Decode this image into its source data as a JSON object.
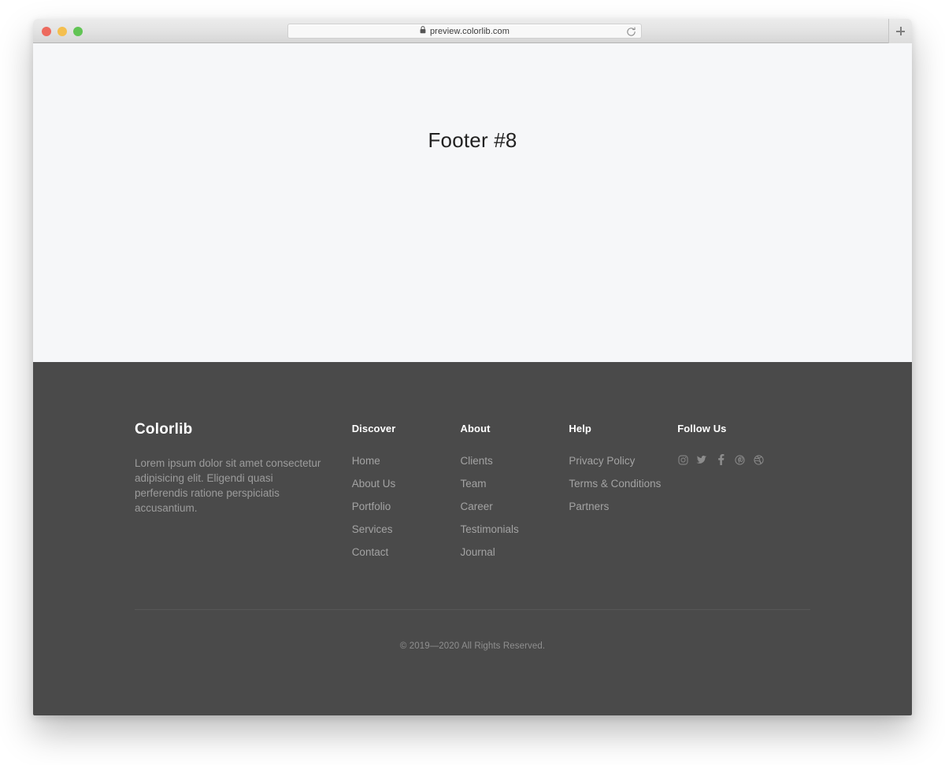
{
  "browser": {
    "traffic_lights": [
      {
        "name": "close",
        "color": "#ed6a5e"
      },
      {
        "name": "minimize",
        "color": "#f4bf4f"
      },
      {
        "name": "zoom",
        "color": "#61c454"
      }
    ],
    "url": "preview.colorlib.com",
    "lock_icon": "lock-icon",
    "reload_icon": "reload-icon",
    "new_tab_icon": "plus-icon"
  },
  "hero": {
    "title": "Footer #8",
    "background": "#f6f7f9"
  },
  "footer": {
    "background": "#4a4a4a",
    "brand": {
      "name": "Colorlib",
      "description": "Lorem ipsum dolor sit amet consectetur adipisicing elit. Eligendi quasi perferendis ratione perspiciatis accusantium."
    },
    "columns": [
      {
        "heading": "Discover",
        "links": [
          "Home",
          "About Us",
          "Portfolio",
          "Services",
          "Contact"
        ]
      },
      {
        "heading": "About",
        "links": [
          "Clients",
          "Team",
          "Career",
          "Testimonials",
          "Journal"
        ]
      },
      {
        "heading": "Help",
        "links": [
          "Privacy Policy",
          "Terms & Conditions",
          "Partners"
        ]
      }
    ],
    "social": {
      "heading": "Follow Us",
      "icons": [
        "instagram-icon",
        "twitter-icon",
        "facebook-icon",
        "pinterest-icon",
        "dribbble-icon"
      ]
    },
    "copyright": "© 2019—2020 All Rights Reserved."
  }
}
